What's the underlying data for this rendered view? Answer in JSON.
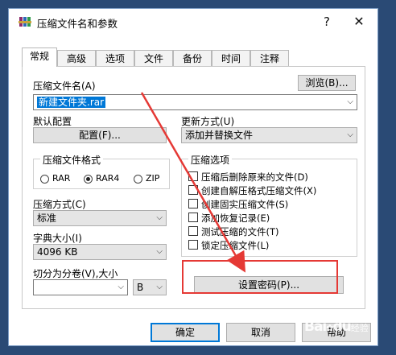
{
  "window": {
    "title": "压缩文件名和参数",
    "help": "?",
    "close": "✕"
  },
  "tabs": [
    "常规",
    "高级",
    "选项",
    "文件",
    "备份",
    "时间",
    "注释"
  ],
  "general": {
    "archive_name_label": "压缩文件名(A)",
    "browse_button": "浏览(B)...",
    "archive_name_value": "新建文件夹.rar",
    "default_profile_label": "默认配置",
    "profiles_button": "配置(F)...",
    "update_mode_label": "更新方式(U)",
    "update_mode_value": "添加并替换文件",
    "format_group": {
      "title": "压缩文件格式",
      "options": [
        "RAR",
        "RAR4",
        "ZIP"
      ],
      "selected": "RAR4"
    },
    "method_label": "压缩方式(C)",
    "method_value": "标准",
    "dict_label": "字典大小(I)",
    "dict_value": "4096 KB",
    "split_label": "切分为分卷(V),大小",
    "split_value": "",
    "split_unit": "B",
    "options_group": {
      "title": "压缩选项",
      "items": [
        "压缩后删除原来的文件(D)",
        "创建自解压格式压缩文件(X)",
        "创建固实压缩文件(S)",
        "添加恢复记录(E)",
        "测试压缩的文件(T)",
        "锁定压缩文件(L)"
      ]
    },
    "set_password_button": "设置密码(P)..."
  },
  "footer": {
    "ok": "确定",
    "cancel": "取消",
    "help": "帮助"
  },
  "watermark": {
    "brand": "Bai",
    "brand_du": "du",
    "sub": "经验"
  },
  "colors": {
    "highlight": "#0078d7",
    "annotation": "#e53935"
  }
}
